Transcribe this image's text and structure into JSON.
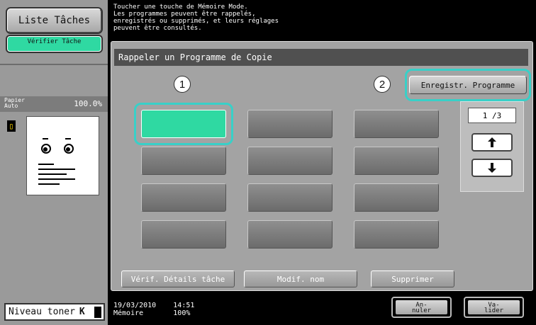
{
  "left_panel": {
    "jobs_list_label": "Liste Tâches",
    "verify_job_label": "Vérifier Tâche",
    "paper_label": "Papier Auto",
    "zoom": "100.0%",
    "doc_tray_icon": "tray-1-icon",
    "toner_label": "Niveau toner",
    "toner_glyph": "K"
  },
  "message": "Toucher une touche de Mémoire Mode.\nLes programmes peuvent être rappelés,\nenregistrés ou supprimés, et leurs réglages\npeuvent être consultés.",
  "panel": {
    "title": "Rappeler un Programme de Copie",
    "badge_1": "1",
    "badge_2": "2",
    "register_label": "Enregistr. Programme",
    "pager": {
      "page": "1 /3",
      "up_icon": "arrow-up-icon",
      "down_icon": "arrow-down-icon"
    },
    "actions": {
      "verify_details": "Vérif. Détails tâche",
      "rename": "Modif. nom",
      "delete": "Supprimer"
    }
  },
  "status": {
    "datetime": "19/03/2010    14:51",
    "memory": "Mémoire       100%",
    "cancel_label": "An-\nnuler",
    "ok_label": "Va-\nlider"
  },
  "colors": {
    "accent": "#2fd9a2",
    "highlight": "#38d0c8"
  }
}
